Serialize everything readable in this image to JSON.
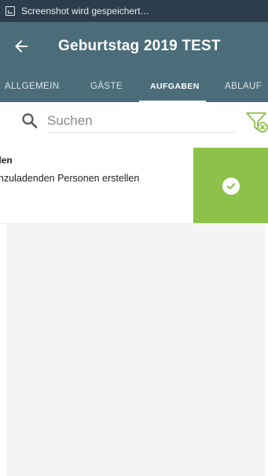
{
  "statusbar": {
    "notification_icon": "screenshot-icon",
    "text": "Screenshot wird gespeichert…"
  },
  "appbar": {
    "back_icon": "arrow-left-icon",
    "title": "Geburtstag 2019 TEST"
  },
  "tabs": [
    {
      "label": "ALLGEMEIN",
      "active": false
    },
    {
      "label": "GÄSTE",
      "active": false
    },
    {
      "label": "AUFGABEN",
      "active": true
    },
    {
      "label": "ABLAUF",
      "active": false
    }
  ],
  "search": {
    "icon": "search-icon",
    "placeholder": "Suchen",
    "value": ""
  },
  "filter": {
    "icon": "filter-clear-icon"
  },
  "tasks": [
    {
      "title": "llen",
      "description": "nzuladenden Personen erstellen",
      "swipe_action_icon": "check-circle-icon"
    }
  ],
  "colors": {
    "statusbar": "#2c3e4c",
    "appbar": "#4b6d79",
    "accent_green": "#8dc149",
    "content_bg": "#f4f4f4"
  }
}
